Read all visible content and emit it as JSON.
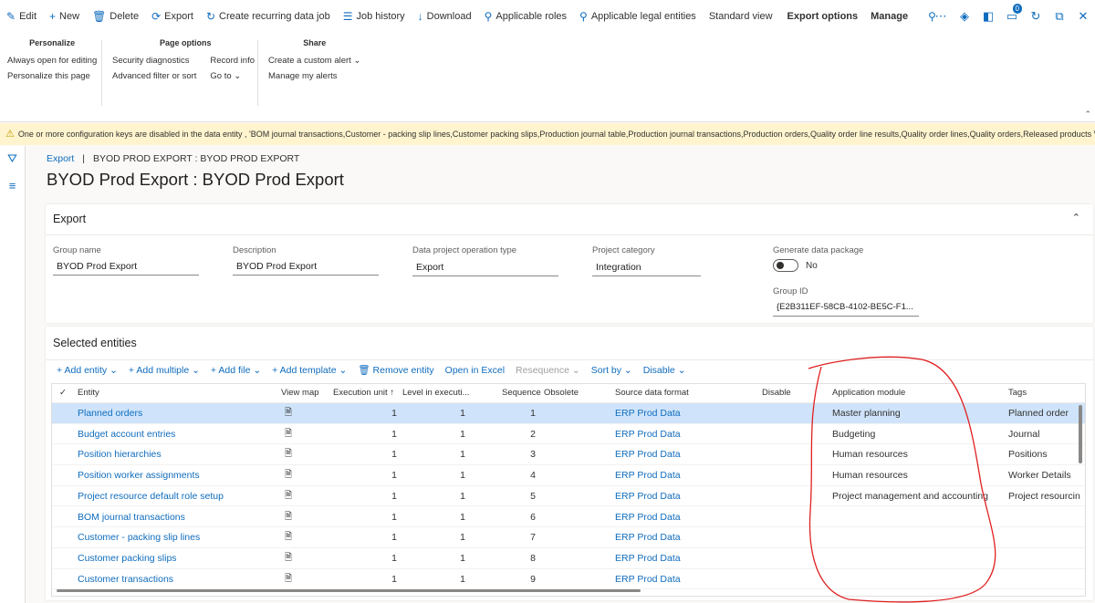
{
  "toolbar": {
    "edit": "Edit",
    "new": "New",
    "delete": "Delete",
    "export": "Export",
    "recurring": "Create recurring data job",
    "history": "Job history",
    "download": "Download",
    "roles": "Applicable roles",
    "legal": "Applicable legal entities",
    "standard_view": "Standard view",
    "export_options": "Export options",
    "manage": "Manage",
    "notification_count": "0"
  },
  "ribbon": {
    "personalize": {
      "title": "Personalize",
      "items": [
        "Always open for editing",
        "Personalize this page"
      ]
    },
    "page_options": {
      "title": "Page options",
      "col1": [
        "Security diagnostics",
        "Advanced filter or sort"
      ],
      "col2": [
        "Record info",
        "Go to"
      ]
    },
    "share": {
      "title": "Share",
      "items": [
        "Create a custom alert",
        "Manage my alerts"
      ]
    }
  },
  "warning": "One or more configuration keys are disabled in the data entity , 'BOM journal transactions,Customer - packing slip lines,Customer packing slips,Production journal table,Production journal transactions,Production orders,Quality order line results,Quality order lines,Quality orders,Released products V2,...",
  "breadcrumb": {
    "link": "Export",
    "sep": "|",
    "current": "BYOD PROD EXPORT : BYOD PROD EXPORT"
  },
  "page_title": "BYOD Prod Export : BYOD Prod Export",
  "export_section": {
    "header": "Export",
    "fields": {
      "group_name_label": "Group name",
      "group_name": "BYOD Prod Export",
      "description_label": "Description",
      "description": "BYOD Prod Export",
      "op_type_label": "Data project operation type",
      "op_type": "Export",
      "category_label": "Project category",
      "category": "Integration",
      "gen_pkg_label": "Generate data package",
      "gen_pkg": "No",
      "group_id_label": "Group ID",
      "group_id": "{E2B311EF-58CB-4102-BE5C-F1..."
    }
  },
  "entities_section": {
    "header": "Selected entities",
    "actions": {
      "add_entity": "Add entity",
      "add_multiple": "Add multiple",
      "add_file": "Add file",
      "add_template": "Add template",
      "remove_entity": "Remove entity",
      "open_excel": "Open in Excel",
      "resequence": "Resequence",
      "sort_by": "Sort by",
      "disable": "Disable"
    },
    "columns": {
      "entity": "Entity",
      "view_map": "View map",
      "exec_unit": "Execution unit",
      "level": "Level in executi...",
      "sequence": "Sequence",
      "obsolete": "Obsolete",
      "source_format": "Source data format",
      "disable": "Disable",
      "app_module": "Application module",
      "tags": "Tags"
    },
    "rows": [
      {
        "entity": "Planned orders",
        "exec": "1",
        "level": "1",
        "seq": "1",
        "format": "ERP Prod Data",
        "module": "Master planning",
        "tags": "Planned order"
      },
      {
        "entity": "Budget account entries",
        "exec": "1",
        "level": "1",
        "seq": "2",
        "format": "ERP Prod Data",
        "module": "Budgeting",
        "tags": "Journal"
      },
      {
        "entity": "Position hierarchies",
        "exec": "1",
        "level": "1",
        "seq": "3",
        "format": "ERP Prod Data",
        "module": "Human resources",
        "tags": "Positions"
      },
      {
        "entity": "Position worker assignments",
        "exec": "1",
        "level": "1",
        "seq": "4",
        "format": "ERP Prod Data",
        "module": "Human resources",
        "tags": "Worker Details"
      },
      {
        "entity": "Project resource default role setup",
        "exec": "1",
        "level": "1",
        "seq": "5",
        "format": "ERP Prod Data",
        "module": "Project management and accounting",
        "tags": "Project resourcin"
      },
      {
        "entity": "BOM journal transactions",
        "exec": "1",
        "level": "1",
        "seq": "6",
        "format": "ERP Prod Data",
        "module": "",
        "tags": ""
      },
      {
        "entity": "Customer - packing slip lines",
        "exec": "1",
        "level": "1",
        "seq": "7",
        "format": "ERP Prod Data",
        "module": "",
        "tags": ""
      },
      {
        "entity": "Customer packing slips",
        "exec": "1",
        "level": "1",
        "seq": "8",
        "format": "ERP Prod Data",
        "module": "",
        "tags": ""
      },
      {
        "entity": "Customer transactions",
        "exec": "1",
        "level": "1",
        "seq": "9",
        "format": "ERP Prod Data",
        "module": "",
        "tags": ""
      }
    ]
  },
  "colors": {
    "accent": "#0f6cbd",
    "selected_row": "#cfe4fa",
    "warning_bg": "#fff4ce",
    "annotation": "#e02020"
  }
}
